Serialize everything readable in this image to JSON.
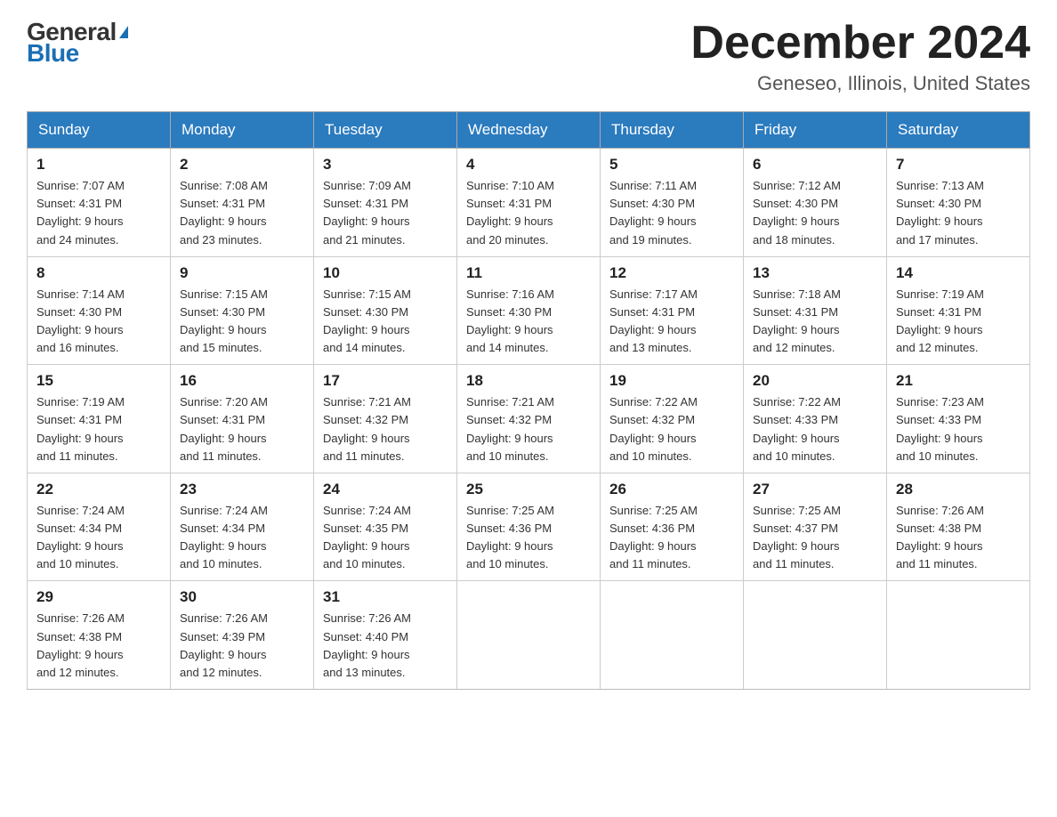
{
  "header": {
    "logo_general": "General",
    "logo_blue": "Blue",
    "month_title": "December 2024",
    "location": "Geneseo, Illinois, United States"
  },
  "days_of_week": [
    "Sunday",
    "Monday",
    "Tuesday",
    "Wednesday",
    "Thursday",
    "Friday",
    "Saturday"
  ],
  "weeks": [
    [
      {
        "day": "1",
        "sunrise": "7:07 AM",
        "sunset": "4:31 PM",
        "daylight": "9 hours and 24 minutes."
      },
      {
        "day": "2",
        "sunrise": "7:08 AM",
        "sunset": "4:31 PM",
        "daylight": "9 hours and 23 minutes."
      },
      {
        "day": "3",
        "sunrise": "7:09 AM",
        "sunset": "4:31 PM",
        "daylight": "9 hours and 21 minutes."
      },
      {
        "day": "4",
        "sunrise": "7:10 AM",
        "sunset": "4:31 PM",
        "daylight": "9 hours and 20 minutes."
      },
      {
        "day": "5",
        "sunrise": "7:11 AM",
        "sunset": "4:30 PM",
        "daylight": "9 hours and 19 minutes."
      },
      {
        "day": "6",
        "sunrise": "7:12 AM",
        "sunset": "4:30 PM",
        "daylight": "9 hours and 18 minutes."
      },
      {
        "day": "7",
        "sunrise": "7:13 AM",
        "sunset": "4:30 PM",
        "daylight": "9 hours and 17 minutes."
      }
    ],
    [
      {
        "day": "8",
        "sunrise": "7:14 AM",
        "sunset": "4:30 PM",
        "daylight": "9 hours and 16 minutes."
      },
      {
        "day": "9",
        "sunrise": "7:15 AM",
        "sunset": "4:30 PM",
        "daylight": "9 hours and 15 minutes."
      },
      {
        "day": "10",
        "sunrise": "7:15 AM",
        "sunset": "4:30 PM",
        "daylight": "9 hours and 14 minutes."
      },
      {
        "day": "11",
        "sunrise": "7:16 AM",
        "sunset": "4:30 PM",
        "daylight": "9 hours and 14 minutes."
      },
      {
        "day": "12",
        "sunrise": "7:17 AM",
        "sunset": "4:31 PM",
        "daylight": "9 hours and 13 minutes."
      },
      {
        "day": "13",
        "sunrise": "7:18 AM",
        "sunset": "4:31 PM",
        "daylight": "9 hours and 12 minutes."
      },
      {
        "day": "14",
        "sunrise": "7:19 AM",
        "sunset": "4:31 PM",
        "daylight": "9 hours and 12 minutes."
      }
    ],
    [
      {
        "day": "15",
        "sunrise": "7:19 AM",
        "sunset": "4:31 PM",
        "daylight": "9 hours and 11 minutes."
      },
      {
        "day": "16",
        "sunrise": "7:20 AM",
        "sunset": "4:31 PM",
        "daylight": "9 hours and 11 minutes."
      },
      {
        "day": "17",
        "sunrise": "7:21 AM",
        "sunset": "4:32 PM",
        "daylight": "9 hours and 11 minutes."
      },
      {
        "day": "18",
        "sunrise": "7:21 AM",
        "sunset": "4:32 PM",
        "daylight": "9 hours and 10 minutes."
      },
      {
        "day": "19",
        "sunrise": "7:22 AM",
        "sunset": "4:32 PM",
        "daylight": "9 hours and 10 minutes."
      },
      {
        "day": "20",
        "sunrise": "7:22 AM",
        "sunset": "4:33 PM",
        "daylight": "9 hours and 10 minutes."
      },
      {
        "day": "21",
        "sunrise": "7:23 AM",
        "sunset": "4:33 PM",
        "daylight": "9 hours and 10 minutes."
      }
    ],
    [
      {
        "day": "22",
        "sunrise": "7:24 AM",
        "sunset": "4:34 PM",
        "daylight": "9 hours and 10 minutes."
      },
      {
        "day": "23",
        "sunrise": "7:24 AM",
        "sunset": "4:34 PM",
        "daylight": "9 hours and 10 minutes."
      },
      {
        "day": "24",
        "sunrise": "7:24 AM",
        "sunset": "4:35 PM",
        "daylight": "9 hours and 10 minutes."
      },
      {
        "day": "25",
        "sunrise": "7:25 AM",
        "sunset": "4:36 PM",
        "daylight": "9 hours and 10 minutes."
      },
      {
        "day": "26",
        "sunrise": "7:25 AM",
        "sunset": "4:36 PM",
        "daylight": "9 hours and 11 minutes."
      },
      {
        "day": "27",
        "sunrise": "7:25 AM",
        "sunset": "4:37 PM",
        "daylight": "9 hours and 11 minutes."
      },
      {
        "day": "28",
        "sunrise": "7:26 AM",
        "sunset": "4:38 PM",
        "daylight": "9 hours and 11 minutes."
      }
    ],
    [
      {
        "day": "29",
        "sunrise": "7:26 AM",
        "sunset": "4:38 PM",
        "daylight": "9 hours and 12 minutes."
      },
      {
        "day": "30",
        "sunrise": "7:26 AM",
        "sunset": "4:39 PM",
        "daylight": "9 hours and 12 minutes."
      },
      {
        "day": "31",
        "sunrise": "7:26 AM",
        "sunset": "4:40 PM",
        "daylight": "9 hours and 13 minutes."
      },
      null,
      null,
      null,
      null
    ]
  ],
  "labels": {
    "sunrise": "Sunrise:",
    "sunset": "Sunset:",
    "daylight": "Daylight:"
  }
}
